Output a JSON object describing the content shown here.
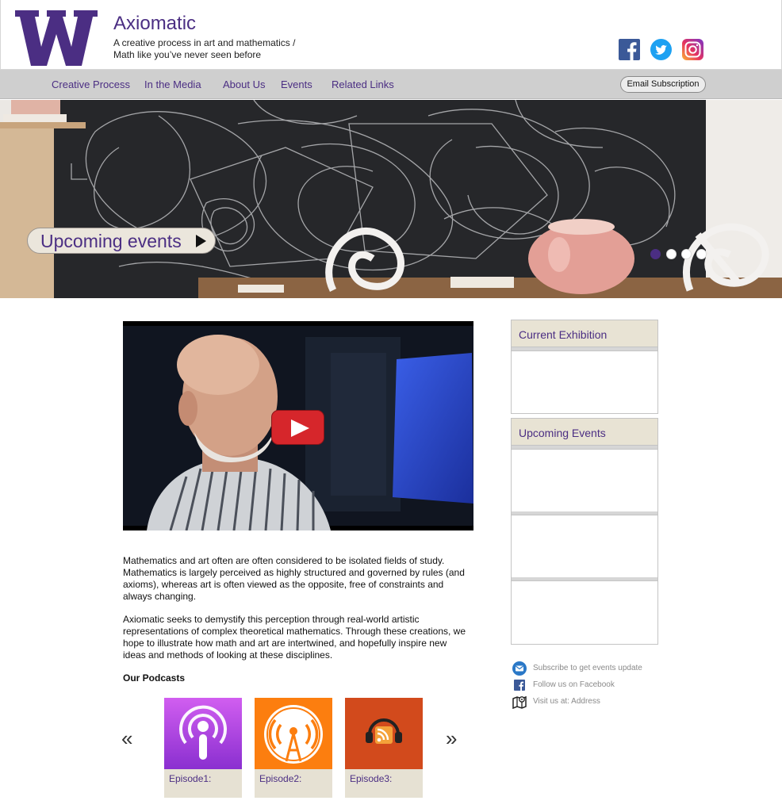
{
  "header": {
    "logo_letter": "W",
    "title": "Axiomatic",
    "tagline_line1": "A creative process in art and mathematics /",
    "tagline_line2": "Math like you’ve never seen before",
    "social": [
      "facebook-icon",
      "twitter-icon",
      "instagram-icon"
    ]
  },
  "nav": {
    "items": [
      {
        "label": "Creative Process"
      },
      {
        "label": "In the Media"
      },
      {
        "label": "About Us"
      },
      {
        "label": "Events"
      },
      {
        "label": "Related Links"
      }
    ],
    "subscribe_label": "Email Subscription"
  },
  "hero": {
    "button_label": "Upcoming events",
    "slide_count": 4,
    "active_slide": 1
  },
  "main": {
    "paragraph1": "Mathematics and art often are often considered to be isolated fields of study. Mathematics is largely perceived as highly structured and governed by rules (and axioms), whereas art is often viewed as the opposite, free of constraints and always changing.",
    "paragraph2": "Axiomatic seeks to demystify this perception through real-world artistic representations of complex theoretical mathematics. Through these creations, we hope to illustrate how math and art are intertwined, and hopefully inspire new ideas and methods of looking at these disciplines.",
    "podcasts_title": "Our Podcasts",
    "prev_label": "«",
    "next_label": "»",
    "episodes": [
      {
        "label": "Episode1:",
        "icon": "apple-podcasts-icon"
      },
      {
        "label": "Episode2:",
        "icon": "overcast-icon"
      },
      {
        "label": "Episode3:",
        "icon": "podcast-rss-headphones-icon"
      }
    ]
  },
  "sidebar": {
    "current_exhibition_title": "Current Exhibition",
    "upcoming_events_title": "Upcoming Events",
    "contact": [
      {
        "text": "Subscribe to get events update",
        "icon": "mail-icon"
      },
      {
        "text": "Follow us on Facebook",
        "icon": "facebook-icon"
      },
      {
        "text": "Visit us at: Address",
        "icon": "map-icon"
      }
    ]
  },
  "colors": {
    "brand_purple": "#4b2e83",
    "nav_bg": "#cfcfcf",
    "panel_header_bg": "#e8e3d4",
    "play_red": "#d6262b"
  }
}
